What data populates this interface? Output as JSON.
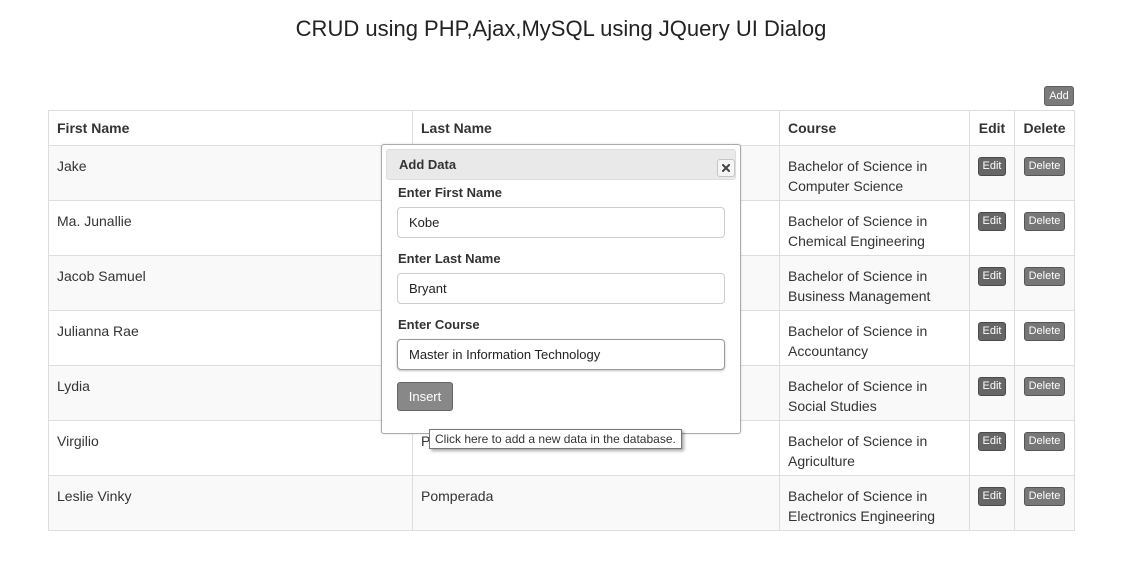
{
  "page_title": "CRUD using PHP,Ajax,MySQL using JQuery UI Dialog",
  "add_button_label": "Add",
  "table": {
    "headers": {
      "first_name": "First Name",
      "last_name": "Last Name",
      "course": "Course",
      "edit": "Edit",
      "delete": "Delete"
    },
    "edit_label": "Edit",
    "delete_label": "Delete",
    "rows": [
      {
        "first_name": "Jake",
        "last_name": "",
        "course": "Bachelor of Science in Computer Science"
      },
      {
        "first_name": "Ma. Junallie",
        "last_name": "",
        "course": "Bachelor of Science in Chemical Engineering"
      },
      {
        "first_name": "Jacob Samuel",
        "last_name": "",
        "course": "Bachelor of Science in Business Management"
      },
      {
        "first_name": "Julianna Rae",
        "last_name": "",
        "course": "Bachelor of Science in Accountancy"
      },
      {
        "first_name": "Lydia",
        "last_name": "",
        "course": "Bachelor of Science in Social Studies"
      },
      {
        "first_name": "Virgilio",
        "last_name": "P",
        "course": "Bachelor of Science in Agriculture"
      },
      {
        "first_name": "Leslie Vinky",
        "last_name": "Pomperada",
        "course": "Bachelor of Science in Electronics Engineering"
      }
    ]
  },
  "dialog": {
    "title": "Add Data",
    "close_icon": "close-icon",
    "first_name_label": "Enter First Name",
    "first_name_value": "Kobe",
    "last_name_label": "Enter Last Name",
    "last_name_value": "Bryant",
    "course_label": "Enter Course",
    "course_value": "Master in Information Technology",
    "insert_label": "Insert"
  },
  "tooltip": "Click here to add a new data in the database.",
  "colors": {
    "button_dark": "#666666",
    "dialog_titlebar": "#e9e9e9",
    "stripe": "#f9f9f9"
  }
}
